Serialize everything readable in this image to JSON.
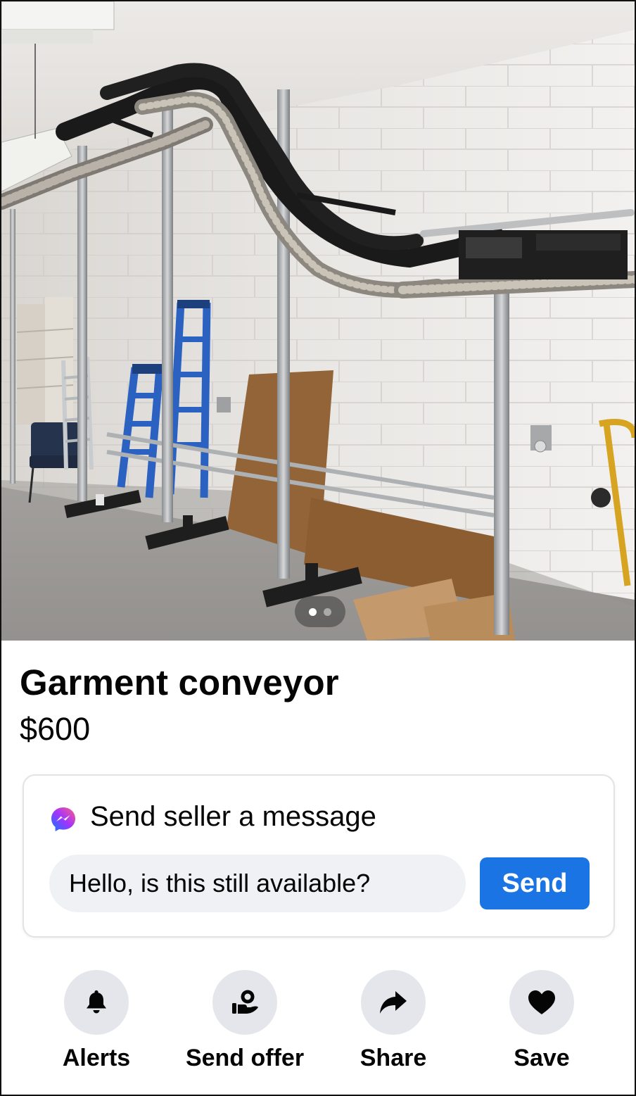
{
  "listing": {
    "title": "Garment conveyor",
    "price": "$600",
    "photo": {
      "subject": "garment-conveyor-photo",
      "pager": {
        "total": 2,
        "active": 1
      }
    }
  },
  "message": {
    "heading": "Send seller a message",
    "icon": "messenger-icon",
    "input_value": "Hello, is this still available?",
    "send_label": "Send"
  },
  "actions": [
    {
      "label": "Alerts",
      "icon": "bell-icon"
    },
    {
      "label": "Send offer",
      "icon": "offer-icon"
    },
    {
      "label": "Share",
      "icon": "share-icon"
    },
    {
      "label": "Save",
      "icon": "heart-icon"
    }
  ],
  "colors": {
    "accent": "#1b74e4",
    "input_bg": "#eff1f4",
    "action_circle_bg": "#e4e6eb",
    "text": "#050505"
  }
}
